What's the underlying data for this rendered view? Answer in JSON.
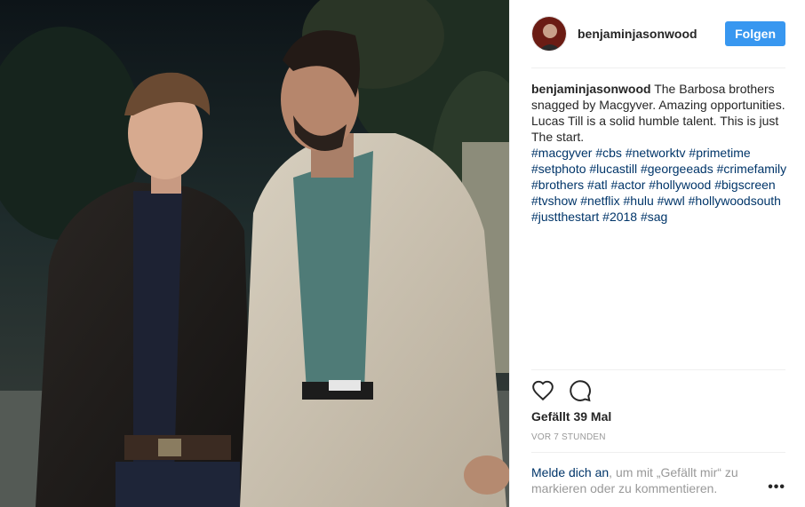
{
  "post": {
    "username": "benjaminjasonwood",
    "follow_label": "Folgen",
    "caption_user": "benjaminjasonwood",
    "caption_text": "The Barbosa brothers snagged by Macgyver. Amazing opportunities. Lucas Till is a solid humble talent. This is just The start.",
    "hashtags": "#macgyver #cbs #networktv #primetime #setphoto #lucastill #georgeeads #crimefamily #brothers #atl #actor #hollywood #bigscreen #tvshow #netflix #hulu #wwl #hollywoodsouth #justthestart #2018 #sag",
    "likes": "Gefällt 39 Mal",
    "timestamp": "VOR 7 STUNDEN",
    "login_link": "Melde dich an",
    "login_text": ", um mit „Gefällt mir“ zu markieren oder zu kommentieren.",
    "more_label": "•••"
  },
  "icons": {
    "like": "heart-icon",
    "comment": "comment-icon",
    "more": "more-options-icon"
  },
  "colors": {
    "accent": "#3897f0",
    "hashtag": "#003569",
    "muted": "#999999",
    "text": "#262626"
  }
}
